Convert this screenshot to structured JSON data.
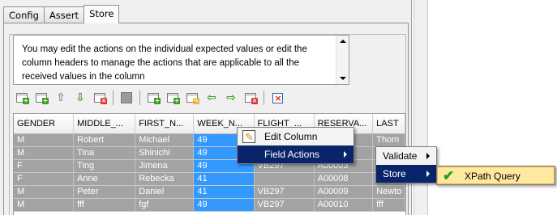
{
  "tabs": [
    {
      "label": "Config"
    },
    {
      "label": "Assert"
    },
    {
      "label": "Store"
    }
  ],
  "description": {
    "cut_line": "` ' '",
    "text": "You may edit the actions on the individual expected values or edit the column headers to manage the actions that are applicable to all the received values in the column"
  },
  "toolbar": {
    "icons": [
      "add-row-icon",
      "add-row-after-icon",
      "move-up-icon",
      "move-down-icon",
      "delete-row-icon",
      "disabled-icon",
      "add-column-icon",
      "add-column-after-icon",
      "edit-column-icon",
      "move-left-icon",
      "move-right-icon",
      "delete-column-icon",
      "clear-icon"
    ]
  },
  "table": {
    "columns": [
      "GENDER",
      "MIDDLE_...",
      "FIRST_N...",
      "WEEK_N...",
      "FLIGHT_...",
      "RESERVA...",
      "LAST"
    ],
    "rows": [
      [
        "M",
        "Robert",
        "Michael",
        "49",
        "",
        "",
        "Thom"
      ],
      [
        "M",
        "Tina",
        "Shinichi",
        "49",
        "",
        "",
        ""
      ],
      [
        "F",
        "Ting",
        "Jimena",
        "49",
        "VB297",
        "A00003",
        ""
      ],
      [
        "F",
        "Anne",
        "Rebecka",
        "41",
        "",
        "A00008",
        ""
      ],
      [
        "M",
        "Peter",
        "Daniel",
        "41",
        "VB297",
        "A00009",
        "Newto"
      ],
      [
        "M",
        "fff",
        "fgf",
        "49",
        "VB297",
        "A00010",
        "fff"
      ]
    ]
  },
  "context_menu": {
    "items": [
      {
        "label": "Edit Column",
        "icon": "edit-column-icon"
      },
      {
        "label": "Field Actions",
        "has_submenu": true
      }
    ]
  },
  "submenu_field_actions": {
    "items": [
      {
        "label": "Validate",
        "has_submenu": true
      },
      {
        "label": "Store",
        "has_submenu": true
      }
    ]
  },
  "submenu_store": {
    "items": [
      {
        "label": "XPath Query",
        "icon": "check-icon",
        "checked": true
      }
    ]
  },
  "colors": {
    "selection": "#3399ff",
    "row_bg": "#a3a3a3",
    "menu_highlight": "#0a246a"
  }
}
